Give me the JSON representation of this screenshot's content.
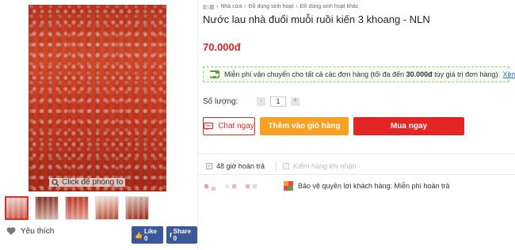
{
  "breadcrumb": [
    "Nhà cửa",
    "Đồ dùng sinh hoạt",
    "Đồ dùng sinh hoạt khác"
  ],
  "product": {
    "title": "Nước lau nhà đuổi muỗi ruồi kiến 3 khoang - NLN",
    "price": "70.000đ"
  },
  "gallery": {
    "zoom_hint": "Click để phóng to",
    "thumbnail_count": 5,
    "active_thumbnail": 0
  },
  "favorite_label": "Yêu thích",
  "social": {
    "like_label": "Like 0",
    "share_label": "Share 0"
  },
  "shipping": {
    "text_before": "Miễn phí vận chuyển cho tất cả các đơn hàng (tối đa đến ",
    "amount": "30.000đ",
    "text_after": " tùy giá trị đơn hàng)",
    "link": "Xem chi tiết"
  },
  "quantity": {
    "label": "Số lượng:",
    "minus": "-",
    "value": "1",
    "plus": "+"
  },
  "buttons": {
    "chat": "Chat ngay",
    "add_to_cart": "Thêm vào giỏ hàng",
    "buy_now": "Mua ngay"
  },
  "guarantees": {
    "return": "48 giờ hoàn trả",
    "inspect": "Kiểm hàng khi nhận"
  },
  "protection": "Bảo vệ quyền lợi khách hàng: Miễn phí hoàn trả",
  "colors": {
    "accent_red": "#e32525",
    "cart_orange": "#f7a024",
    "link_blue": "#2b6cd6",
    "ship_green": "#5a9b3a"
  }
}
